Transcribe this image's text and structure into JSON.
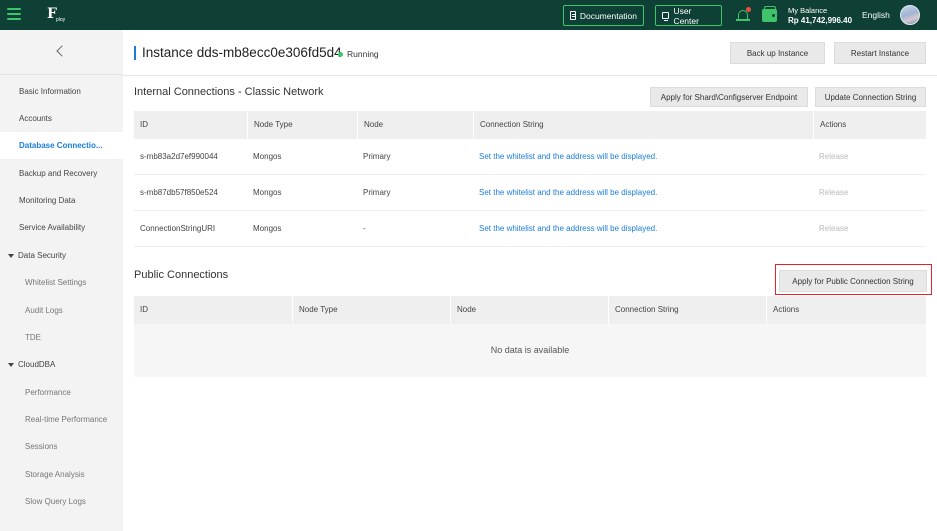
{
  "topbar": {
    "logo_text": "F",
    "logo_sub": "ploy",
    "documentation": "Documentation",
    "user_center": "User Center",
    "balance_label": "My Balance",
    "balance_amount": "Rp 41,742,996.40",
    "language": "English"
  },
  "sidebar": {
    "items": [
      {
        "label": "Basic Information"
      },
      {
        "label": "Accounts"
      },
      {
        "label": "Database Connectio..."
      },
      {
        "label": "Backup and Recovery"
      },
      {
        "label": "Monitoring Data"
      },
      {
        "label": "Service Availability"
      }
    ],
    "groups": [
      {
        "label": "Data Security",
        "items": [
          "Whitelist Settings",
          "Audit Logs",
          "TDE"
        ]
      },
      {
        "label": "CloudDBA",
        "items": [
          "Performance",
          "Real-time Performance",
          "Sessions",
          "Storage Analysis",
          "Slow Query Logs"
        ]
      }
    ]
  },
  "header": {
    "title": "Instance dds-mb8ecc0e306fd5d4",
    "status": "Running",
    "backup_button": "Back up Instance",
    "restart_button": "Restart Instance"
  },
  "internal": {
    "title": "Internal Connections - Classic Network",
    "apply_shard_button": "Apply for Shard\\Configserver Endpoint",
    "update_button": "Update Connection String",
    "columns": [
      "ID",
      "Node Type",
      "Node",
      "Connection String",
      "Actions"
    ],
    "rows": [
      {
        "id": "s-mb83a2d7ef990044",
        "node_type": "Mongos",
        "node": "Primary",
        "conn": "Set the whitelist and the address will be displayed.",
        "action": "Release"
      },
      {
        "id": "s-mb87db57f850e524",
        "node_type": "Mongos",
        "node": "Primary",
        "conn": "Set the whitelist and the address will be displayed.",
        "action": "Release"
      },
      {
        "id": "ConnectionStringURI",
        "node_type": "Mongos",
        "node": "-",
        "conn": "Set the whitelist and the address will be displayed.",
        "action": "Release"
      }
    ]
  },
  "public": {
    "title": "Public Connections",
    "apply_button": "Apply for Public Connection String",
    "columns": [
      "ID",
      "Node Type",
      "Node",
      "Connection String",
      "Actions"
    ],
    "empty_text": "No data is available"
  },
  "colors": {
    "topbar": "#0e4036",
    "accent_green": "#3fc46c",
    "link_blue": "#1a7ddb",
    "highlight_red": "#e0262b"
  },
  "icons": [
    "menu-icon",
    "document-icon",
    "monitor-icon",
    "bell-icon",
    "wallet-icon",
    "chevron-left-icon",
    "caret-down-icon"
  ]
}
